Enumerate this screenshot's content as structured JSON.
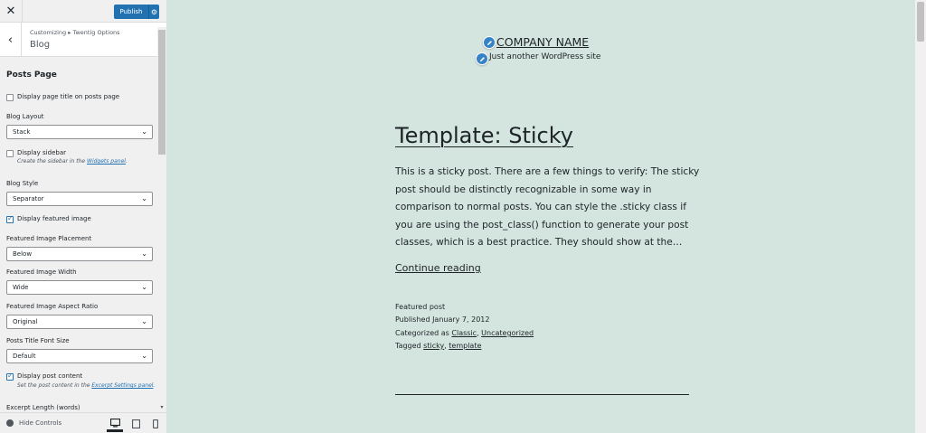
{
  "topbar": {
    "close_label": "✕",
    "publish_label": "Publish",
    "publish_gear": "⚙"
  },
  "section": {
    "breadcrumb_prefix": "Customizing",
    "breadcrumb_sep": "▸",
    "breadcrumb_parent": "Twentig Options",
    "title": "Blog",
    "back_icon": "‹"
  },
  "controls": {
    "posts_page_heading": "Posts Page",
    "display_page_title": {
      "label": "Display page title on posts page",
      "checked": false
    },
    "blog_layout": {
      "label": "Blog Layout",
      "value": "Stack"
    },
    "display_sidebar": {
      "label": "Display sidebar",
      "checked": false,
      "desc_prefix": "Create the sidebar in the ",
      "desc_link": "Widgets panel",
      "desc_suffix": "."
    },
    "blog_style": {
      "label": "Blog Style",
      "value": "Separator"
    },
    "display_featured_image": {
      "label": "Display featured image",
      "checked": true
    },
    "featured_image_placement": {
      "label": "Featured Image Placement",
      "value": "Below"
    },
    "featured_image_width": {
      "label": "Featured Image Width",
      "value": "Wide"
    },
    "featured_image_aspect": {
      "label": "Featured Image Aspect Ratio",
      "value": "Original"
    },
    "posts_title_font_size": {
      "label": "Posts Title Font Size",
      "value": "Default"
    },
    "display_post_content": {
      "label": "Display post content",
      "checked": true,
      "desc_prefix": "Set the post content in the ",
      "desc_link": "Excerpt Settings panel",
      "desc_suffix": "."
    },
    "excerpt_length": {
      "label": "Excerpt Length (words)"
    }
  },
  "footer": {
    "hide_controls_label": "Hide Controls",
    "devices": [
      "desktop-icon",
      "tablet-icon",
      "mobile-icon"
    ],
    "active_device": "desktop"
  },
  "preview": {
    "site_title": "COMPANY NAME",
    "tagline": "Just another WordPress site",
    "post_title": "Template: Sticky",
    "excerpt": "This is a sticky post. There are a few things to verify: The sticky post should be distinctly recognizable in some way in comparison to normal posts. You can style the .sticky class if you are using the post_class() function to generate your post classes, which is a best practice. They should show at the…",
    "continue_label": "Continue reading",
    "meta": {
      "featured": "Featured post",
      "published_prefix": "Published ",
      "published_date": "January 7, 2012",
      "categorized_prefix": "Categorized as ",
      "categories": [
        "Classic",
        "Uncategorized"
      ],
      "tagged_prefix": "Tagged ",
      "tags": [
        "sticky",
        "template"
      ]
    }
  },
  "colors": {
    "accent": "#2271b1",
    "preview_bg": "#d4e4df",
    "sidebar_bg": "#f0f0f1"
  }
}
